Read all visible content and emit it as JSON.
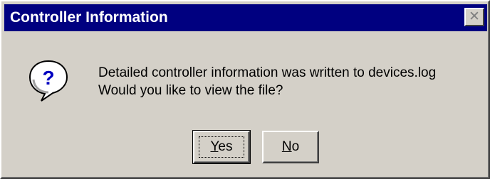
{
  "window": {
    "title": "Controller Information",
    "close_glyph": "✕"
  },
  "dialog": {
    "icon": "question-icon",
    "icon_glyph": "?",
    "message_line1": "Detailed controller information was written to devices.log",
    "message_line2": "Would you like to view the file?"
  },
  "buttons": {
    "yes": {
      "mnemonic": "Y",
      "rest": "es"
    },
    "no": {
      "mnemonic": "N",
      "rest": "o"
    }
  },
  "colors": {
    "titlebar": "#000080",
    "face": "#d4d0c8"
  }
}
